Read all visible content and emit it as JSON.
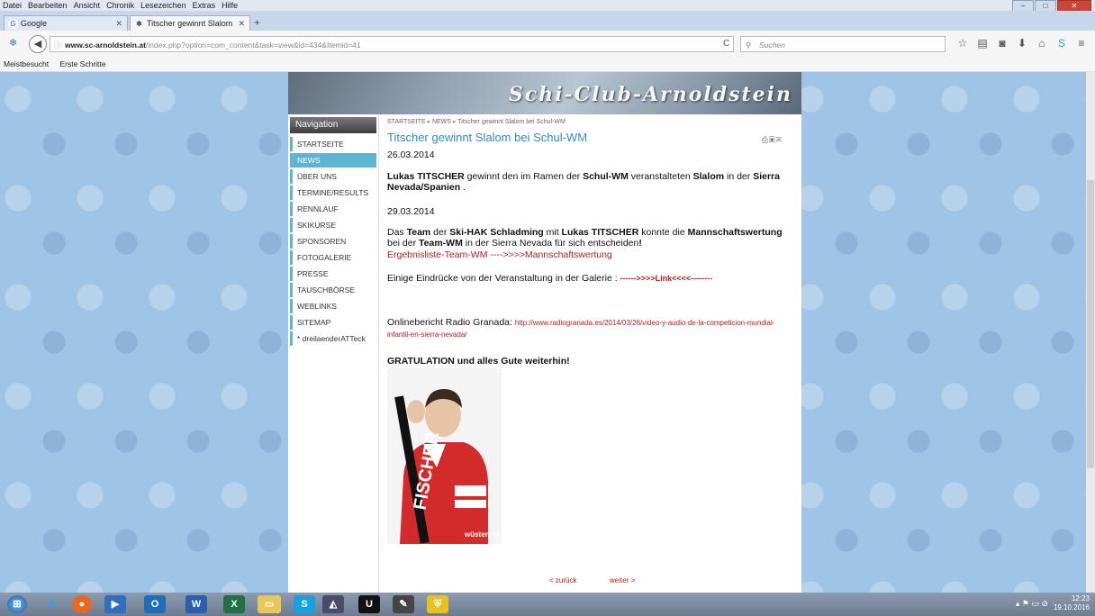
{
  "menu": [
    "Datei",
    "Bearbeiten",
    "Ansicht",
    "Chronik",
    "Lesezeichen",
    "Extras",
    "Hilfe"
  ],
  "tabs": [
    {
      "label": "Google",
      "icon": "G"
    },
    {
      "label": "Titscher gewinnt Slalom be...",
      "icon": "❄"
    }
  ],
  "url": {
    "host": "www.sc-arnoldstein.at",
    "path": "/index.php?option=com_content&task=view&id=434&Itemid=41"
  },
  "search_placeholder": "Suchen",
  "bookmarks": [
    "Meistbesucht",
    "Erste Schritte"
  ],
  "site": {
    "title": "Schi-Club-Arnoldstein"
  },
  "nav": {
    "heading": "Navigation",
    "items": [
      "STARTSEITE",
      "NEWS",
      "ÜBER UNS",
      "TERMINE/RESULTS",
      "RENNLAUF",
      "SKIKURSE",
      "SPONSOREN",
      "FOTOGALERIE",
      "PRESSE",
      "TAUSCHBÖRSE",
      "WEBLINKS",
      "SITEMAP",
      "* dreilaenderATTeck"
    ]
  },
  "breadcrumb": [
    "STARTSEITE",
    "NEWS",
    "Titscher gewinnt Slalom bei Schul-WM"
  ],
  "article": {
    "title": "Titscher gewinnt Slalom bei Schul-WM",
    "date1": "26.03.2014",
    "p1": {
      "a": "Lukas TITSCHER",
      "b": " gewinnt den im Ramen der ",
      "c": "Schul-WM",
      "d": " veranstalteten ",
      "e": "Slalom",
      "f": " in der ",
      "g": "Sierra Nevada/Spanien",
      "h": " ."
    },
    "date2": "29.03.2014",
    "p2": {
      "a": "Das ",
      "b": "Team",
      "c": " der ",
      "d": "Ski-HAK Schladming",
      "e": " mit ",
      "f": "Lukas TITSCHER",
      "g": " konnte die ",
      "h": "Mannschaftswertung",
      "i": " bei der ",
      "j": "Team-WM",
      "k": " in der Sierra Nevada für sich entscheiden",
      "l": "!"
    },
    "result_link": "Ergebnisliste-Team-WM ---->>>>Mannschaftswertung",
    "gallery_text": "Einige Eindrücke von der Veranstaltung in der Galerie : ",
    "gallery_link": "------>>>>Link<<<<--------",
    "radio_text": "Onlinebericht Radio Granada: ",
    "radio_link": "http://www.radiogranada.es/2014/03/26/video-y-audio-de-la-competicion-mundial-infantil-en-sierra-nevada/",
    "congrats": "GRATULATION und alles Gute weiterhin!",
    "photo_labels": {
      "brand": "FISCHER",
      "sponsor": "wüstenrot"
    },
    "prev": "< zurück",
    "next": "weiter >"
  },
  "clock": {
    "time": "12:23",
    "date": "19.10.2016"
  }
}
